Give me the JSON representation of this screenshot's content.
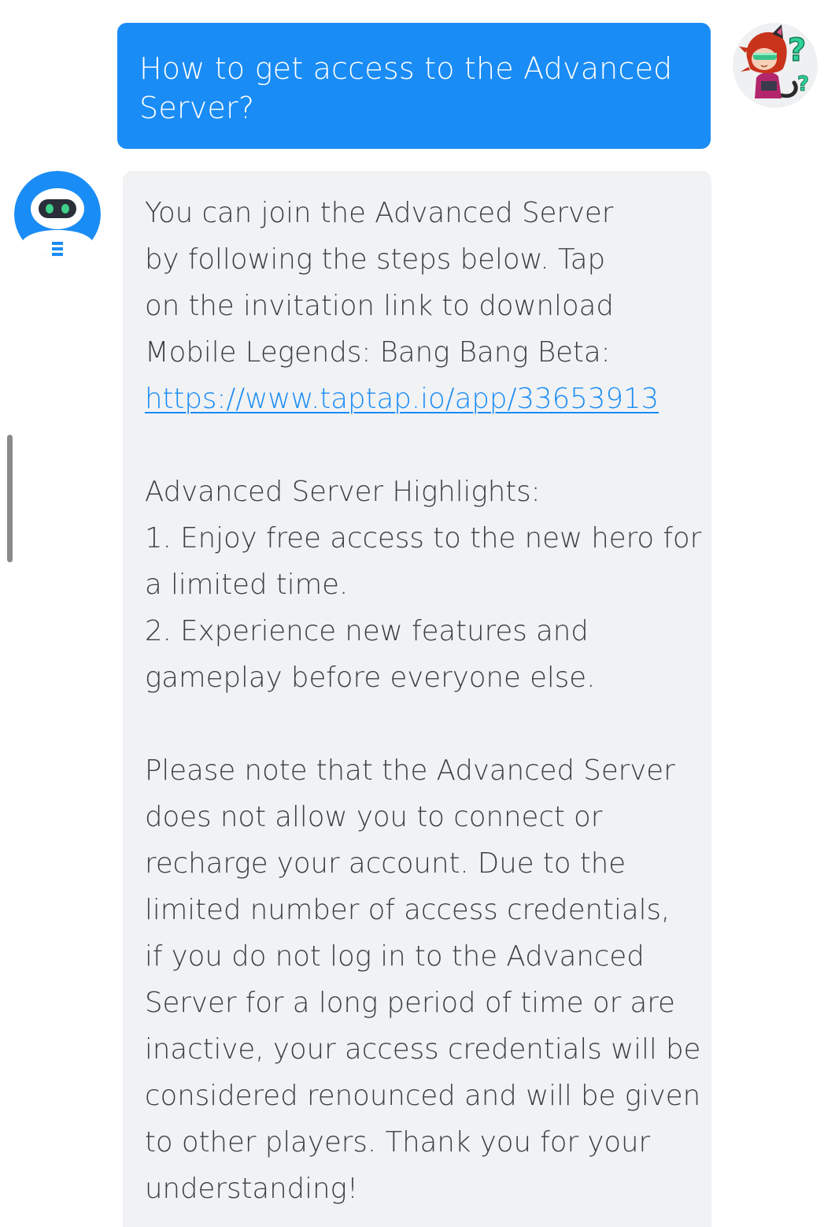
{
  "user_message": {
    "lines": [
      "How to get access to the Advanced",
      "Server?"
    ]
  },
  "bot_message": {
    "intro_lines": [
      "You can join the Advanced Server",
      "by following the steps below. Tap",
      "on the invitation link to download",
      "Mobile Legends: Bang Bang Beta:"
    ],
    "link_text": "https://www.taptap.io/app/33653913",
    "highlights_lines": [
      "Advanced Server Highlights:",
      "1. Enjoy free access to the new hero for",
      "a limited time.",
      "2. Experience new features and",
      "gameplay before everyone else."
    ],
    "note_lines": [
      "Please note that the Advanced Server",
      "does not allow you to connect or",
      "recharge your account. Due to the",
      "limited number of access credentials,",
      "if you do not log in to the Advanced",
      "Server for a long period of time or are",
      "inactive, your access credentials will be",
      "considered renounced and will be given",
      "to other players. Thank you for your",
      "understanding!"
    ]
  },
  "avatars": {
    "user": "user-avatar-hero-icon",
    "bot": "bot-avatar-robot-icon"
  },
  "colors": {
    "user_bubble": "#1a8cf5",
    "bot_bubble": "#f1f2f4",
    "link": "#1a8cf5",
    "text": "#3b3f45"
  }
}
